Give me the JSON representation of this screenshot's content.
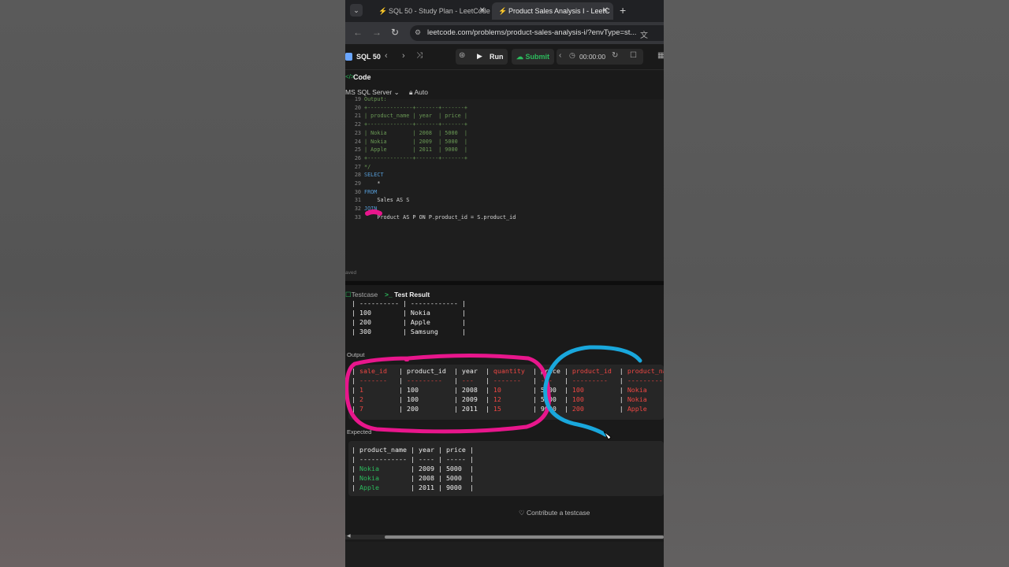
{
  "browser": {
    "tabs": [
      {
        "title": "SQL 50 - Study Plan - LeetCode",
        "active": false
      },
      {
        "title": "Product Sales Analysis I - LeetC",
        "active": true
      }
    ],
    "url": "leetcode.com/problems/product-sales-analysis-i/?envType=st..."
  },
  "header": {
    "title": "SQL 50",
    "run_label": "Run",
    "submit_label": "Submit",
    "timer": "00:00:00"
  },
  "code_panel": {
    "title": "Code",
    "language": "MS SQL Server",
    "auto_label": "Auto",
    "saved_label": "aved",
    "lines": [
      {
        "n": "19",
        "text": "Output:",
        "cls": "comment"
      },
      {
        "n": "20",
        "text": "+--------------+-------+-------+",
        "cls": "comment"
      },
      {
        "n": "21",
        "text": "| product_name | year  | price |",
        "cls": "comment"
      },
      {
        "n": "22",
        "text": "+--------------+-------+-------+",
        "cls": "comment"
      },
      {
        "n": "23",
        "text": "| Nokia        | 2008  | 5000  |",
        "cls": "comment"
      },
      {
        "n": "24",
        "text": "| Nokia        | 2009  | 5000  |",
        "cls": "comment"
      },
      {
        "n": "25",
        "text": "| Apple        | 2011  | 9000  |",
        "cls": "comment"
      },
      {
        "n": "26",
        "text": "+--------------+-------+-------+",
        "cls": "comment"
      },
      {
        "n": "27",
        "text": "*/",
        "cls": "comment"
      },
      {
        "n": "28",
        "text": "SELECT",
        "cls": "kw"
      },
      {
        "n": "29",
        "text": "    *",
        "cls": "plain"
      },
      {
        "n": "30",
        "text": "FROM",
        "cls": "kw"
      },
      {
        "n": "31",
        "text": "    Sales AS S",
        "cls": "plain"
      },
      {
        "n": "32",
        "text": "JOIN",
        "cls": "kw"
      },
      {
        "n": "33",
        "text": "    Product AS P ON P.product_id = S.product_id",
        "cls": "plain"
      }
    ]
  },
  "result_panel": {
    "testcase_tab": "Testcase",
    "result_tab": "Test Result",
    "input_rows": [
      "| ---------- | ------------ |",
      "| 100        | Nokia        |",
      "| 200        | Apple        |",
      "| 300        | Samsung      |"
    ],
    "output_label": "Output",
    "output_header": [
      "sale_id",
      "product_id",
      "year",
      "quantity",
      "price",
      "product_id",
      "product_name"
    ],
    "output_rows": [
      [
        "1",
        "100",
        "2008",
        "10",
        "5000",
        "100",
        "Nokia"
      ],
      [
        "2",
        "100",
        "2009",
        "12",
        "5000",
        "100",
        "Nokia"
      ],
      [
        "7",
        "200",
        "2011",
        "15",
        "9000",
        "200",
        "Apple"
      ]
    ],
    "expected_label": "Expected",
    "expected_header": [
      "product_name",
      "year",
      "price"
    ],
    "expected_rows": [
      [
        "Nokia",
        "2009",
        "5000"
      ],
      [
        "Nokia",
        "2008",
        "5000"
      ],
      [
        "Apple",
        "2011",
        "9000"
      ]
    ],
    "contribute_label": "Contribute a testcase"
  },
  "colors": {
    "accent_green": "#2cbb5d",
    "error_red": "#ef4743",
    "annotation_pink": "#e8168c",
    "annotation_blue": "#19a7dc"
  }
}
